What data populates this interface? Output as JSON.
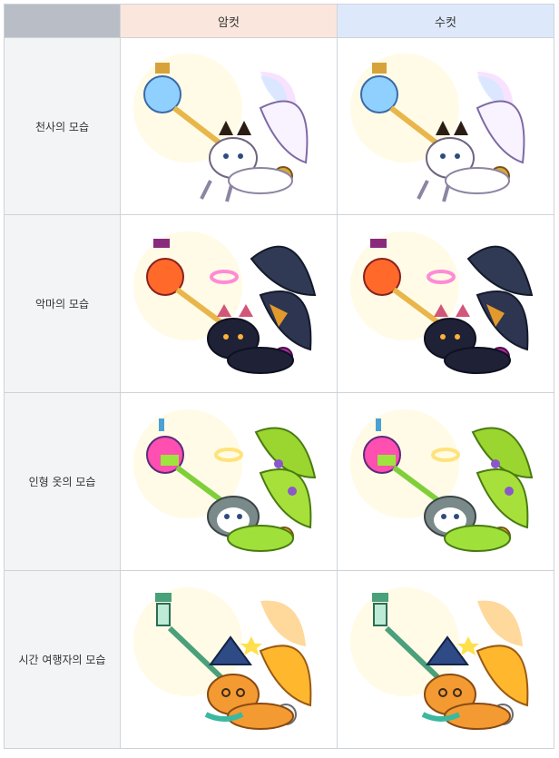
{
  "header": {
    "corner": "",
    "female": "암컷",
    "male": "수컷"
  },
  "rows": [
    {
      "label": "천사의 모습",
      "icon": "angel-cat-pet-icon"
    },
    {
      "label": "악마의 모습",
      "icon": "devil-cat-pet-icon"
    },
    {
      "label": "인형 옷의 모습",
      "icon": "doll-costume-cat-pet-icon"
    },
    {
      "label": "시간 여행자의 모습",
      "icon": "time-traveler-cat-pet-icon"
    }
  ],
  "colors": {
    "header_corner": "#b9bec6",
    "header_female": "#fbe6dd",
    "header_male": "#dde9fb",
    "label_bg": "#f3f4f6",
    "border": "#cfd3d8"
  }
}
